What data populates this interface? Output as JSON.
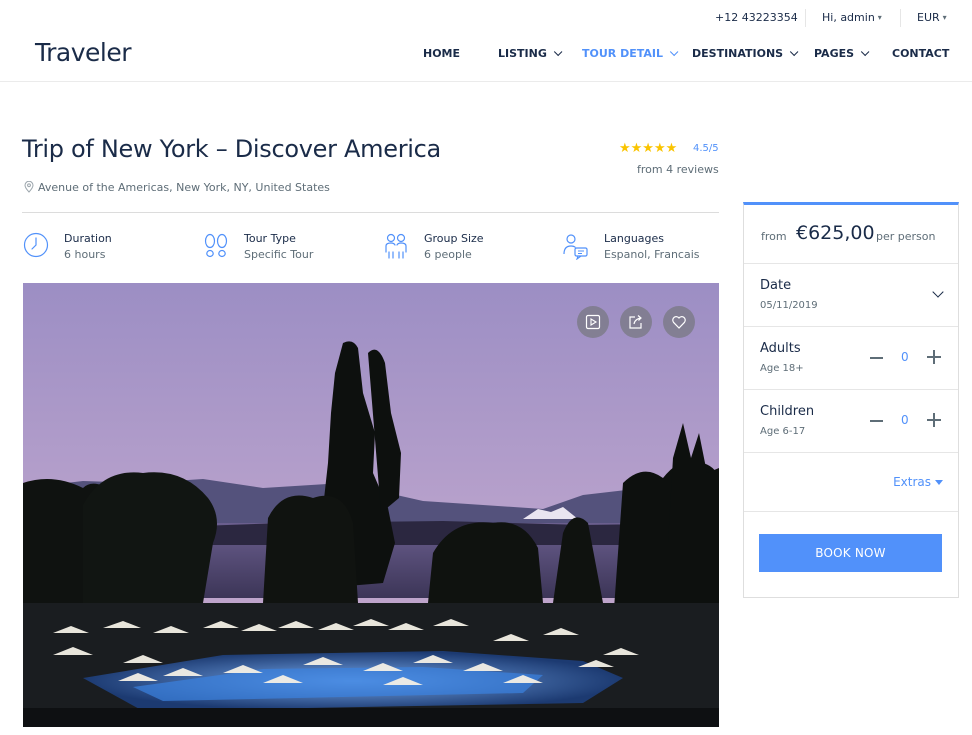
{
  "topbar": {
    "phone": "+12 43223354",
    "user": "Hi, admin",
    "currency": "EUR"
  },
  "brand": {
    "logo": "Traveler"
  },
  "nav": {
    "items": [
      {
        "label": "HOME",
        "dropdown": false,
        "active": false
      },
      {
        "label": "LISTING",
        "dropdown": true,
        "active": false
      },
      {
        "label": "TOUR DETAIL",
        "dropdown": true,
        "active": true
      },
      {
        "label": "DESTINATIONS",
        "dropdown": true,
        "active": false
      },
      {
        "label": "PAGES",
        "dropdown": true,
        "active": false
      },
      {
        "label": "CONTACT",
        "dropdown": false,
        "active": false
      }
    ]
  },
  "tour": {
    "title": "Trip of New York – Discover America",
    "address": "Avenue of the Americas, New York, NY, United States",
    "stars": "★★★★★",
    "rating": "4.5/5",
    "reviews": "from 4 reviews",
    "facts": [
      {
        "icon": "clock-icon",
        "label": "Duration",
        "value": "6 hours"
      },
      {
        "icon": "footprints-icon",
        "label": "Tour Type",
        "value": "Specific Tour"
      },
      {
        "icon": "group-icon",
        "label": "Group Size",
        "value": "6 people"
      },
      {
        "icon": "languages-icon",
        "label": "Languages",
        "value": "Espanol, Francais"
      }
    ]
  },
  "booking": {
    "from": "from",
    "price": "€625,00",
    "per": "per person",
    "date_label": "Date",
    "date_value": "05/11/2019",
    "adults_label": "Adults",
    "adults_sub": "Age 18+",
    "adults_value": "0",
    "children_label": "Children",
    "children_sub": "Age 6-17",
    "children_value": "0",
    "extras": "Extras",
    "book_now": "BOOK NOW"
  },
  "colors": {
    "accent": "#5191fa",
    "text": "#1a2b48",
    "muted": "#5e6d77",
    "star": "#fac400"
  }
}
